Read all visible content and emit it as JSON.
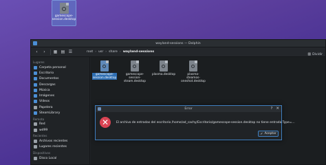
{
  "desktop": {
    "icon_label": "gamescope-session.desktop"
  },
  "window": {
    "title": "wayland-sessions — Dolphin",
    "toolbar": {
      "crumbs": [
        "root",
        "usr",
        "share",
        "wayland-sessions"
      ],
      "view_label": "Dividir"
    },
    "sidebar": {
      "sections": [
        {
          "title": "Lugares",
          "items": [
            "Carpeta personal",
            "Escritorio",
            "Documentos",
            "Descargas",
            "Música",
            "Imágenes",
            "Vídeos",
            "Papelera",
            "SteamLibrary"
          ]
        },
        {
          "title": "Remoto",
          "items": [
            "Red",
            "wd99"
          ]
        },
        {
          "title": "Recientes",
          "items": [
            "Archivos recientes",
            "Lugares recientes"
          ]
        },
        {
          "title": "Dispositivos",
          "items": [
            "Disco Local"
          ]
        }
      ]
    },
    "files": [
      {
        "name": "gamescope-session.desktop",
        "selected": true
      },
      {
        "name": "gamescope-session-steam.desktop",
        "selected": false
      },
      {
        "name": "plasma.desktop",
        "selected": false
      },
      {
        "name": "plasma-steamos-oneshot.desktop",
        "selected": false
      }
    ]
  },
  "dialog": {
    "title": "Error",
    "message": "El archivo de entradas del escritorio /home/ad_cachy/Escritorio/gamescope-session.desktop no tiene entrada Type=...",
    "ok_label": "Aceptar"
  },
  "colors": {
    "accent": "#3f7fc0",
    "error": "#da4453"
  }
}
